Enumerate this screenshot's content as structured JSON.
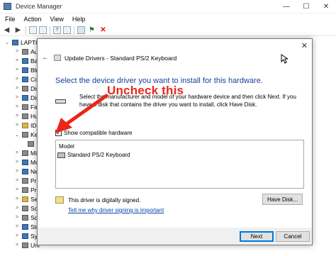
{
  "device_manager": {
    "title": "Device Manager",
    "controls": {
      "minimize": "—",
      "maximize": "☐",
      "close": "✕"
    },
    "menu": [
      "File",
      "Action",
      "View",
      "Help"
    ],
    "tree": [
      {
        "label": "LAPTO",
        "chevron": "⌄"
      },
      {
        "label": "Au",
        "chevron": ">"
      },
      {
        "label": "Bat",
        "chevron": ">"
      },
      {
        "label": "Blu",
        "chevron": ">"
      },
      {
        "label": "Cor",
        "chevron": ">"
      },
      {
        "label": "Dis",
        "chevron": ">"
      },
      {
        "label": "Dis",
        "chevron": ">"
      },
      {
        "label": "Fir",
        "chevron": ">"
      },
      {
        "label": "Hu",
        "chevron": ">"
      },
      {
        "label": "IDE",
        "chevron": ">"
      },
      {
        "label": "Key",
        "chevron": "⌄"
      },
      {
        "label": "",
        "chevron": ""
      },
      {
        "label": "Mic",
        "chevron": ">"
      },
      {
        "label": "Mo",
        "chevron": ">"
      },
      {
        "label": "Net",
        "chevron": ">"
      },
      {
        "label": "Pri",
        "chevron": ">"
      },
      {
        "label": "Pro",
        "chevron": ">"
      },
      {
        "label": "Sec",
        "chevron": ">"
      },
      {
        "label": "Sof",
        "chevron": ">"
      },
      {
        "label": "Sof",
        "chevron": ">"
      },
      {
        "label": "Sto",
        "chevron": ">"
      },
      {
        "label": "Sys",
        "chevron": ">"
      },
      {
        "label": "Uni",
        "chevron": ">"
      }
    ]
  },
  "dialog": {
    "title": "Update Drivers - Standard PS/2 Keyboard",
    "back_icon": "←",
    "close_icon": "✕",
    "heading": "Select the device driver you want to install for this hardware.",
    "description": "Select the manufacturer and model of your hardware device and then click Next. If you have a disk that contains the driver you want to install, click Have Disk.",
    "checkbox_label": "Show compatible hardware",
    "checkbox_checked": "✓",
    "model_header": "Model",
    "models": [
      "Standard PS/2 Keyboard"
    ],
    "signed_text": "This driver is digitally signed.",
    "have_disk_label": "Have Disk...",
    "signing_link": "Tell me why driver signing is important",
    "next_label": "Next",
    "cancel_label": "Cancel"
  },
  "annotation": {
    "text": "Uncheck this",
    "color": "#e8271b"
  }
}
